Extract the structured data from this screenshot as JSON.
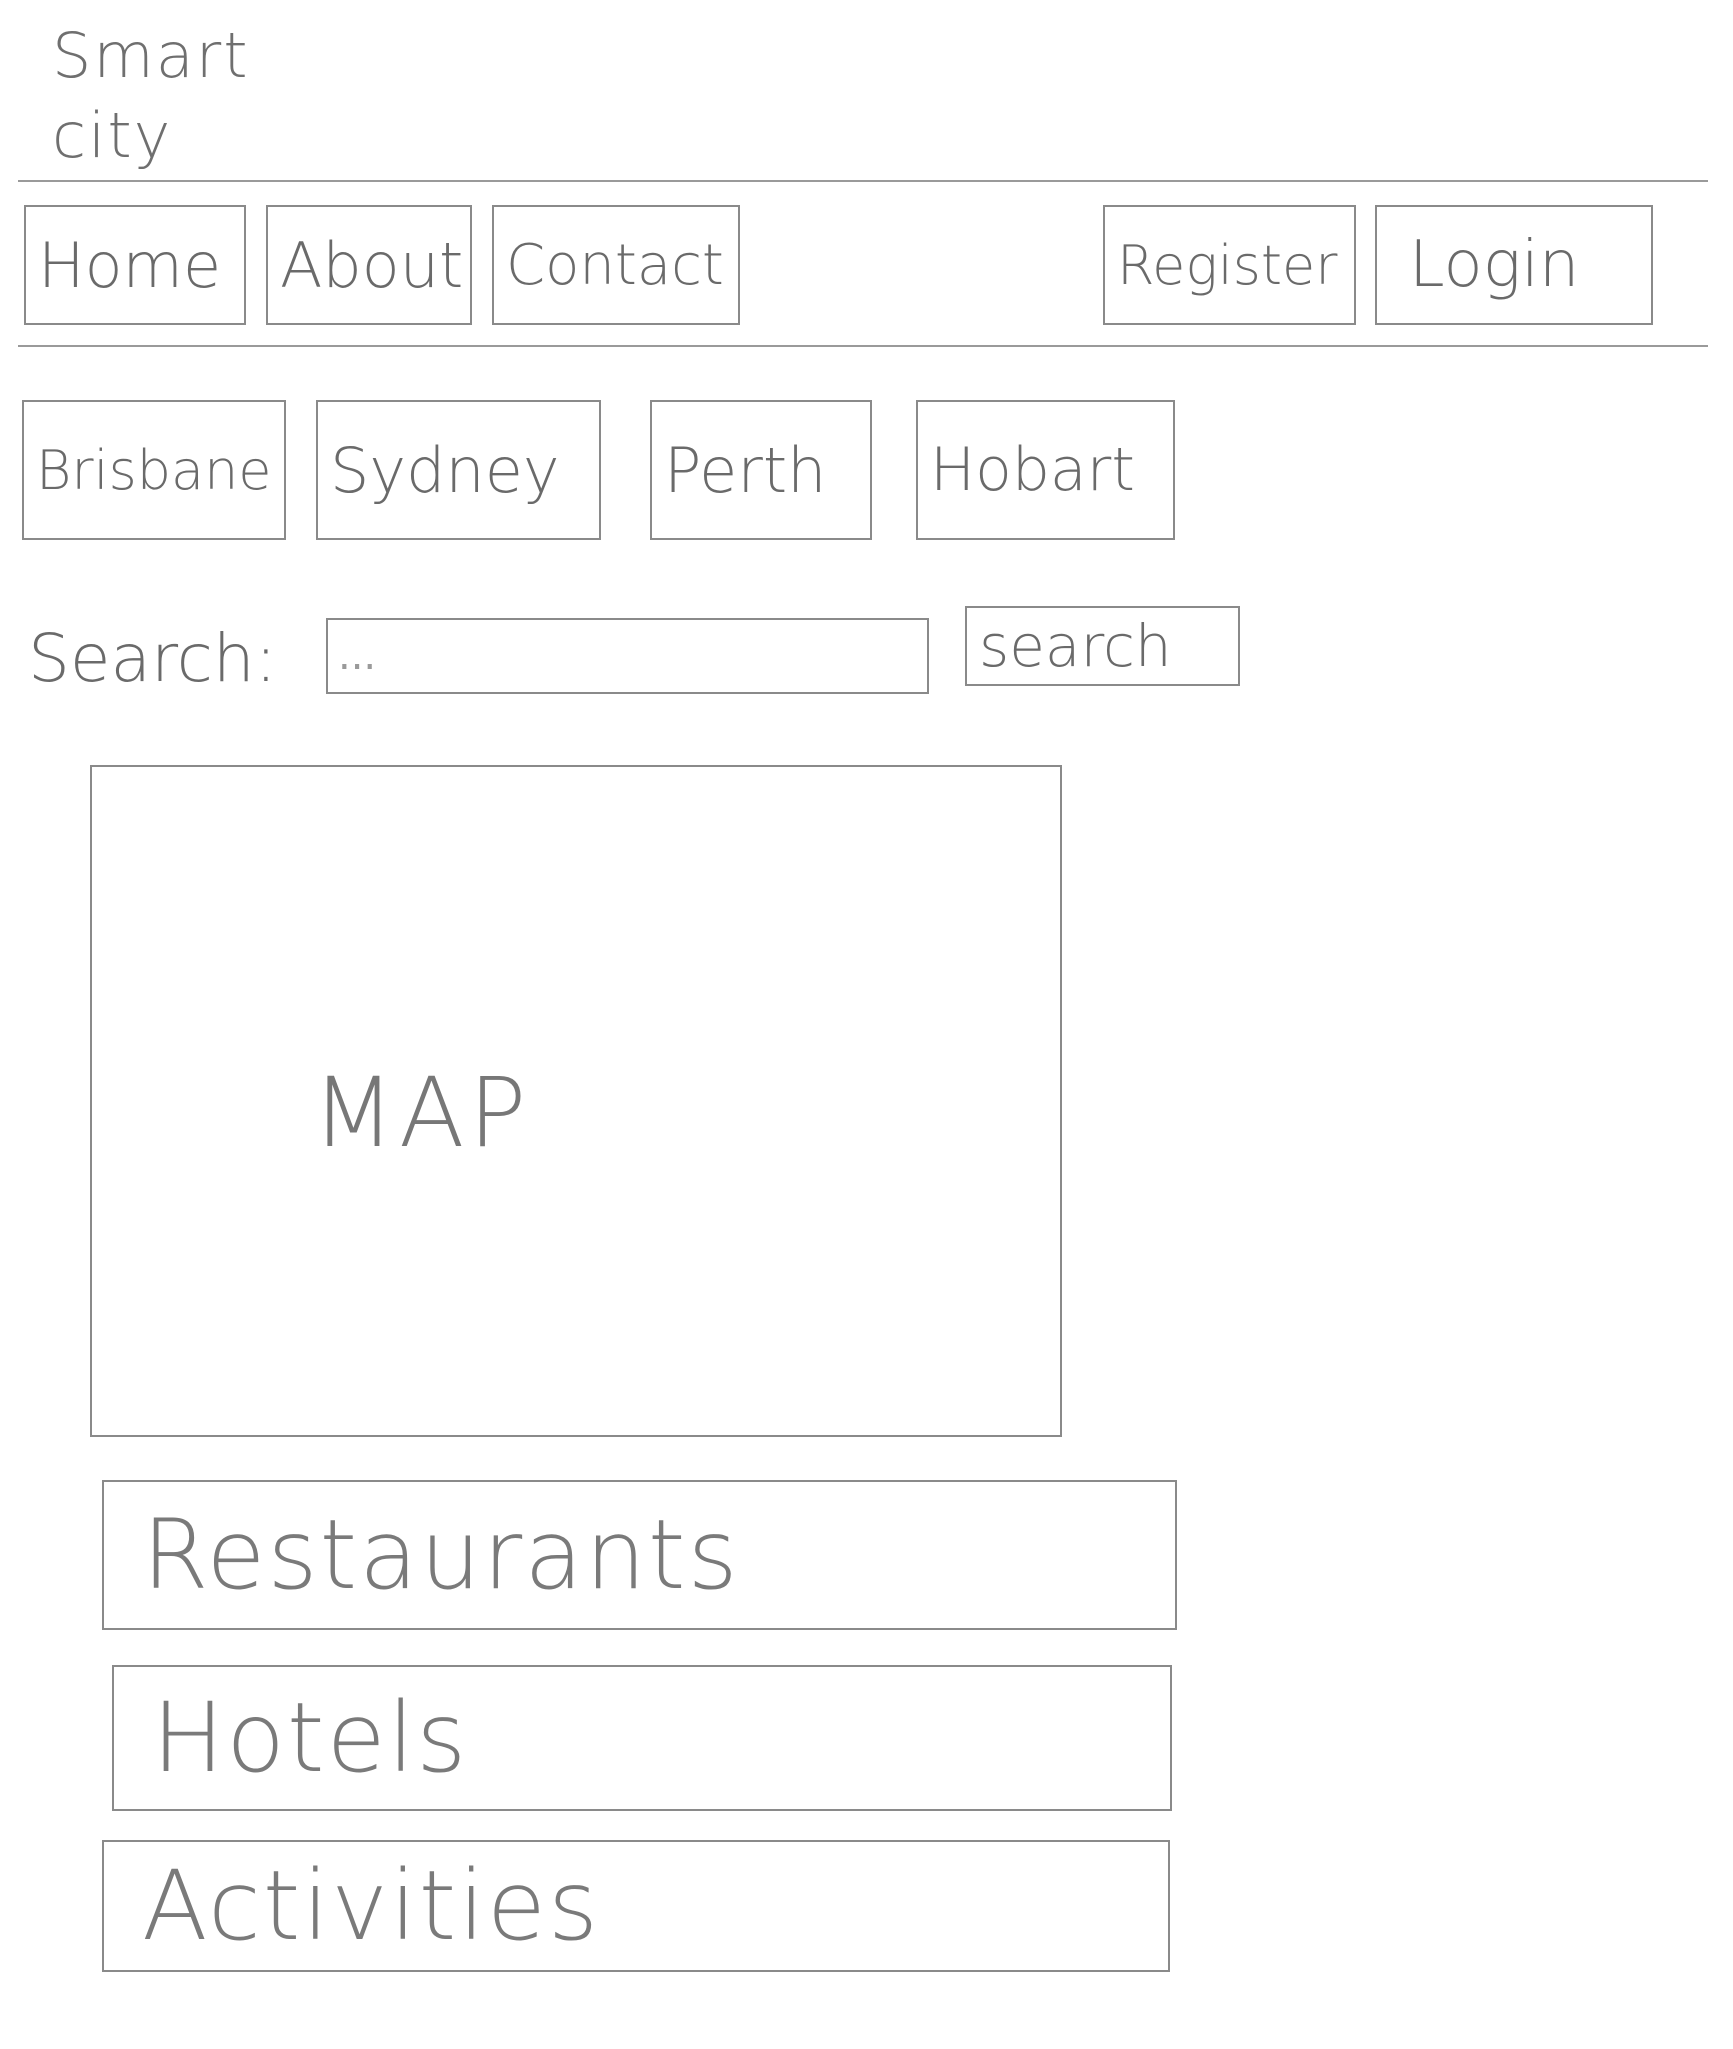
{
  "header": {
    "logo_line1": "Smart",
    "logo_line2": "city"
  },
  "nav": {
    "items": [
      {
        "label": "Home"
      },
      {
        "label": "About"
      },
      {
        "label": "Contact"
      }
    ],
    "register_label": "Register",
    "login_label": "Login"
  },
  "cities": [
    {
      "label": "Brisbane"
    },
    {
      "label": "Sydney"
    },
    {
      "label": "Perth"
    },
    {
      "label": "Hobart"
    }
  ],
  "search": {
    "label": "Search:",
    "placeholder": "...",
    "button_label": "search"
  },
  "map": {
    "label": "MAP"
  },
  "sections": [
    {
      "label": "Restaurants"
    },
    {
      "label": "Hotels"
    },
    {
      "label": "Activities"
    }
  ]
}
